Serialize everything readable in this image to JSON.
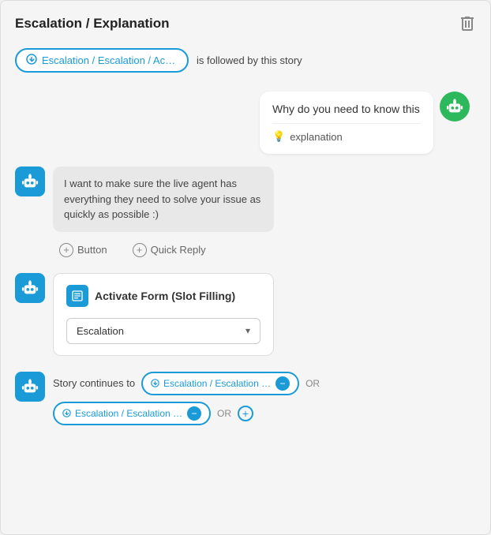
{
  "header": {
    "title": "Escalation / Explanation",
    "delete_label": "delete"
  },
  "trigger": {
    "badge_text": "Escalation / Escalation / Acti...",
    "followed_text": "is followed by this story"
  },
  "chat_bubble": {
    "message": "Why do you need to know this",
    "explanation_label": "explanation"
  },
  "bot_message": {
    "text": "I want to make sure the live agent has everything they need to solve your issue as quickly as possible :)",
    "button_label": "Button",
    "quick_reply_label": "Quick Reply"
  },
  "form": {
    "title": "Activate Form (Slot Filling)",
    "select_value": "Escalation",
    "select_placeholder": "Escalation"
  },
  "story_continues": {
    "label": "Story continues to",
    "story1": "Escalation / Escalation / Sub...",
    "story2": "Escalation / Escalation / Can...",
    "or_label": "OR"
  }
}
